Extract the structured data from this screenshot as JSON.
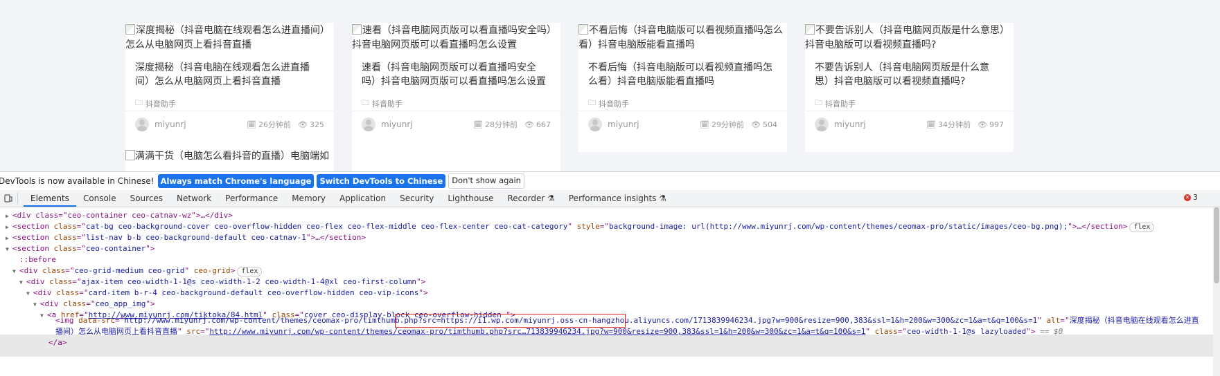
{
  "cards": [
    {
      "alt": "深度揭秘（抖音电脑在线观看怎么进直播间）怎么从电脑网页上看抖音直播",
      "title": "深度揭秘（抖音电脑在线观看怎么进直播间）怎么从电脑网页上看抖音直播",
      "category": "抖音助手",
      "author": "miyunrj",
      "time": "26分钟前",
      "views": "325"
    },
    {
      "alt": "速看（抖音电脑网页版可以看直播吗安全吗）抖音电脑网页版可以看直播吗怎么设置",
      "title": "速看（抖音电脑网页版可以看直播吗安全吗）抖音电脑网页版可以看直播吗怎么设置",
      "category": "抖音助手",
      "author": "miyunrj",
      "time": "28分钟前",
      "views": "667"
    },
    {
      "alt": "不看后悔（抖音电脑版可以看视频直播吗怎么看）抖音电脑版能看直播吗",
      "title": "不看后悔（抖音电脑版可以看视频直播吗怎么看）抖音电脑版能看直播吗",
      "category": "抖音助手",
      "author": "miyunrj",
      "time": "29分钟前",
      "views": "504"
    },
    {
      "alt": "不要告诉别人（抖音电脑网页版是什么意思）抖音电脑版可以看视频直播吗?",
      "title": "不要告诉别人（抖音电脑网页版是什么意思）抖音电脑版可以看视频直播吗?",
      "category": "抖音助手",
      "author": "miyunrj",
      "time": "34分钟前",
      "views": "997"
    }
  ],
  "next_row_alt": "满满干货（电脑怎么看抖音的直播）电脑端如",
  "infobar": {
    "message": "DevTools is now available in Chinese!",
    "btn_match": "Always match Chrome's language",
    "btn_switch": "Switch DevTools to Chinese",
    "btn_dismiss": "Don't show again"
  },
  "tabs": [
    "Elements",
    "Console",
    "Sources",
    "Network",
    "Performance",
    "Memory",
    "Application",
    "Security",
    "Lighthouse",
    "Recorder",
    "Performance insights"
  ],
  "error_count": "3",
  "dom": {
    "line0": "<div class=\"ceo-container ceo-catnav-wz\">…</div>",
    "line1_tag": "<section",
    "line1_class": "cat-bg ceo-background-cover ceo-overflow-hidden ceo-flex ceo-flex-middle ceo-flex-center ceo-cat-category",
    "line1_style": "background-image: url(http://www.miyunrj.com/wp-content/themes/ceomax-pro/static/images/ceo-bg.png);",
    "line1_tail": ">…</section>",
    "badge_flex": "flex",
    "line2_class": "list-nav b-b ceo-background-default ceo-catnav-1",
    "line2_tail": ">…</section>",
    "line3_class": "ceo-container",
    "before": "::before",
    "grid_class": "ceo-grid-medium ceo-grid",
    "grid_attr": "ceo-grid",
    "ajax_class": "ajax-item ceo-width-1-1@s ceo-width-1-2 ceo-width-1-4@xl ceo-first-column",
    "card_class": "card-item b-r-4 ceo-background-default ceo-overflow-hidden ceo-vip-icons",
    "app_img_class": "ceo_app_img",
    "a_href": "http://www.miyunrj.com/tiktoka/84.html",
    "a_class": "cover ceo-display-block ceo-overflow-hidden ",
    "img_datasrc_a": "http://www.miyunrj.com/wp-content/themes/ceomax-pro/timthumb.php?src=",
    "img_datasrc_b": "https://i1.wp.com/miyunrj.oss-cn-hangzhou.aliyuncs.com/1",
    "img_datasrc_c": "713839946234.jpg?w=900&resize=900,383&ssl=1&h=200&w=300&zc=1&a=t&q=100&s=1",
    "img_alt_a": "深度揭秘（抖音电脑在线观看怎么进直",
    "img_alt_b": "播间）怎么从电脑网页上看抖音直播",
    "img_src": "http://www.miyunrj.com/wp-content/themes/ceomax-pro/timthumb.php?src…713839946234.jpg?w=900&resize=900,383&ssl=1&h=200&w=300&zc=1&a=t&q=100&s=1",
    "img_class": "ceo-width-1-1@s lazyloaded",
    "eq0": "== $0",
    "close_a": "</a>"
  }
}
